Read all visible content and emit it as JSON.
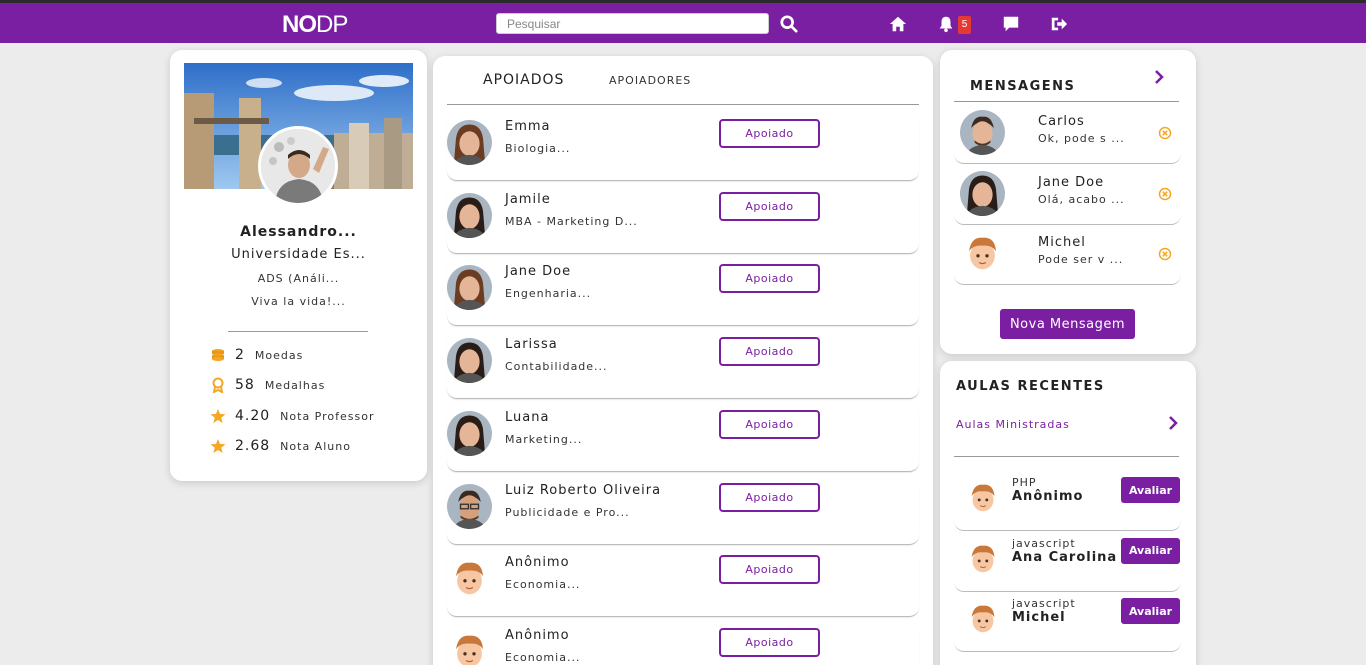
{
  "header": {
    "logo_bold": "NO",
    "logo_thin": "DP",
    "search_placeholder": "Pesquisar",
    "notifications_count": "5",
    "icons": [
      "search-icon",
      "home-icon",
      "bell-icon",
      "chat-icon",
      "logout-icon"
    ]
  },
  "profile": {
    "name": "Alessandro...",
    "university": "Universidade Es...",
    "course": "ADS (Análi...",
    "bio": "Viva la vida!...",
    "stats": [
      {
        "value": "2",
        "label": "Moedas",
        "icon": "coins-icon"
      },
      {
        "value": "58",
        "label": "Medalhas",
        "icon": "medal-icon"
      },
      {
        "value": "4.20",
        "label": "Nota Professor",
        "icon": "star-icon"
      },
      {
        "value": "2.68",
        "label": "Nota Aluno",
        "icon": "star-icon"
      }
    ]
  },
  "tabs": {
    "active": "APOIADOS",
    "inactive": "APOIADORES"
  },
  "supported": [
    {
      "name": "Emma",
      "sub": "Biologia...",
      "button": "Apoiado",
      "avatar": "woman"
    },
    {
      "name": "Jamile",
      "sub": "MBA - Marketing D...",
      "button": "Apoiado",
      "avatar": "woman-dark"
    },
    {
      "name": "Jane Doe",
      "sub": "Engenharia...",
      "button": "Apoiado",
      "avatar": "woman"
    },
    {
      "name": "Larissa",
      "sub": "Contabilidade...",
      "button": "Apoiado",
      "avatar": "woman-dark"
    },
    {
      "name": "Luana",
      "sub": "Marketing...",
      "button": "Apoiado",
      "avatar": "woman-dark"
    },
    {
      "name": "Luiz Roberto Oliveira",
      "sub": "Publicidade e Pro...",
      "button": "Apoiado",
      "avatar": "man-glasses"
    },
    {
      "name": "Anônimo",
      "sub": "Economia...",
      "button": "Apoiado",
      "avatar": "cartoon"
    },
    {
      "name": "Anônimo",
      "sub": "Economia...",
      "button": "Apoiado",
      "avatar": "cartoon"
    }
  ],
  "messages": {
    "title": "MENSAGENS",
    "items": [
      {
        "name": "Carlos",
        "preview": "Ok, pode s ...",
        "avatar": "man"
      },
      {
        "name": "Jane Doe",
        "preview": "Olá, acabo ...",
        "avatar": "woman-dark"
      },
      {
        "name": "Michel",
        "preview": "Pode ser v ...",
        "avatar": "cartoon"
      }
    ],
    "new_button": "Nova Mensagem"
  },
  "classes": {
    "title": "AULAS RECENTES",
    "link": "Aulas Ministradas",
    "items": [
      {
        "subject": "PHP",
        "name": "Anônimo",
        "button": "Avaliar"
      },
      {
        "subject": "javascript",
        "name": "Ana Carolina",
        "button": "Avaliar"
      },
      {
        "subject": "javascript",
        "name": "Michel",
        "button": "Avaliar"
      }
    ]
  },
  "colors": {
    "accent": "#7b1fa2",
    "star": "#f5a623",
    "badge": "#e53935"
  }
}
